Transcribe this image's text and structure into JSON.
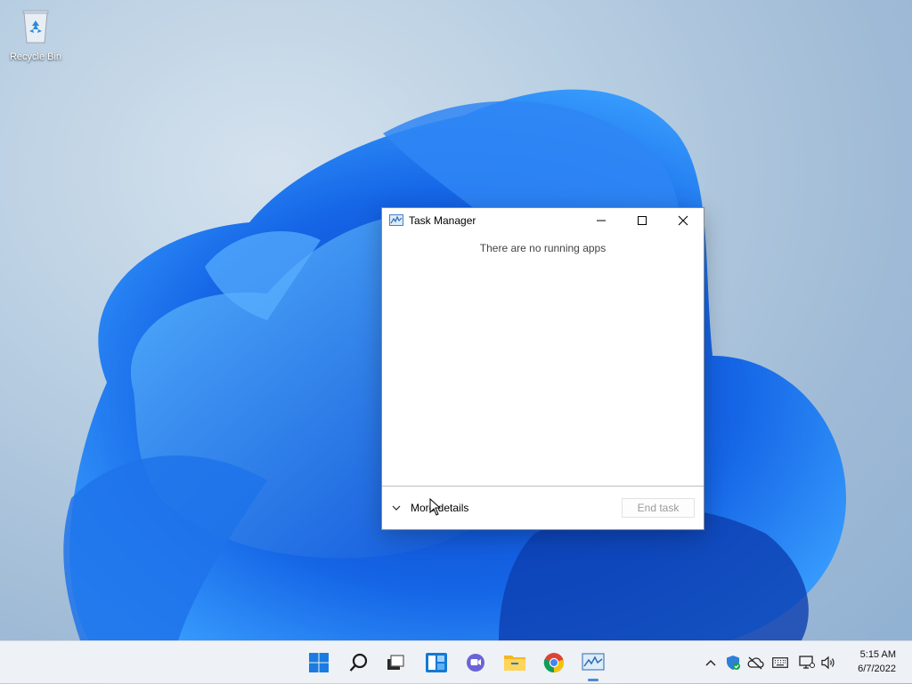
{
  "desktop": {
    "recycle_bin_label": "Recycle Bin"
  },
  "window": {
    "title": "Task Manager",
    "empty_message": "There are no running apps",
    "more_details_label": "More details",
    "end_task_label": "End task"
  },
  "taskbar": {
    "apps": [
      {
        "name": "start",
        "icon": "windows-logo-icon"
      },
      {
        "name": "search",
        "icon": "search-icon"
      },
      {
        "name": "task-view",
        "icon": "task-view-icon"
      },
      {
        "name": "widgets",
        "icon": "widgets-icon"
      },
      {
        "name": "chat",
        "icon": "chat-icon"
      },
      {
        "name": "file-explorer",
        "icon": "folder-icon"
      },
      {
        "name": "chrome",
        "icon": "chrome-icon"
      },
      {
        "name": "task-manager",
        "icon": "task-manager-icon",
        "active": true
      }
    ],
    "clock": {
      "time": "5:15 AM",
      "date": "6/7/2022"
    }
  },
  "colors": {
    "accent": "#0078d4",
    "taskbar": "#eef1f5"
  }
}
